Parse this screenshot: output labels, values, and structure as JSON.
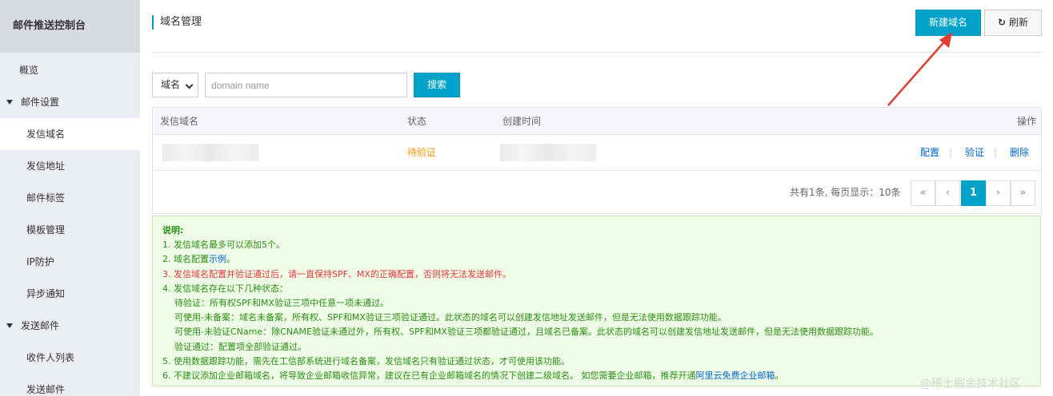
{
  "sidebar": {
    "title": "邮件推送控制台",
    "overview": "概览",
    "mail_settings": {
      "label": "邮件设置",
      "items": [
        "发信域名",
        "发信地址",
        "邮件标签",
        "模板管理",
        "IP防护",
        "异步通知"
      ]
    },
    "send_mail": {
      "label": "发送邮件",
      "items": [
        "收件人列表",
        "发送邮件"
      ]
    }
  },
  "header": {
    "title": "域名管理",
    "new_domain_label": "新建域名",
    "refresh_label": "刷新"
  },
  "filter": {
    "select_value": "域名",
    "placeholder": "domain name",
    "search_label": "搜索"
  },
  "table": {
    "columns": [
      "发信域名",
      "状态",
      "创建时间",
      "操作"
    ],
    "rows": [
      {
        "domain": "",
        "status": "待验证",
        "created": "",
        "actions": [
          "配置",
          "验证",
          "删除"
        ],
        "separator": "|"
      }
    ],
    "pager_info": "共有1条, 每页显示：10条",
    "pages": [
      "«",
      "‹",
      "1",
      "›",
      "»"
    ]
  },
  "notice": {
    "heading": "说明:",
    "l1": "1. 发信域名最多可以添加5个。",
    "l2a": "2. 域名配置",
    "l2_link": "示例",
    "l2b": "。",
    "l3": "3. 发信域名配置并验证通过后，请一直保持SPF、MX的正确配置，否则将无法发送邮件。",
    "l4": "4. 发信域名存在以下几种状态：",
    "s1": "待验证：所有权SPF和MX验证三项中任意一项未通过。",
    "s2": "可使用-未备案：域名未备案，所有权、SPF和MX验证三项验证通过。此状态的域名可以创建发信地址发送邮件，但是无法使用数据跟踪功能。",
    "s3": "可使用-未验证CName：除CNAME验证未通过外，所有权、SPF和MX验证三项都验证通过，且域名已备案。此状态的域名可以创建发信地址发送邮件，但是无法使用数据跟踪功能。",
    "s4": "验证通过：配置项全部验证通过。",
    "l5": "5. 使用数据跟踪功能，需先在工信部系统进行域名备案，发信域名只有验证通过状态，才可使用该功能。",
    "l6a": "6. 不建议添加企业邮箱域名，将导致企业邮箱收信异常，建议在已有企业邮箱域名的情况下创建二级域名。 如您需要企业邮箱，推荐开通",
    "l6_link": "阿里云免费企业邮箱",
    "l6b": "。"
  },
  "watermark": "@稀土掘金技术社区",
  "colors": {
    "primary": "#00a2ca",
    "pending": "#f39800",
    "notice_text": "#2c8f15",
    "alert": "#e4393c",
    "arrow": "#e33b2e"
  }
}
